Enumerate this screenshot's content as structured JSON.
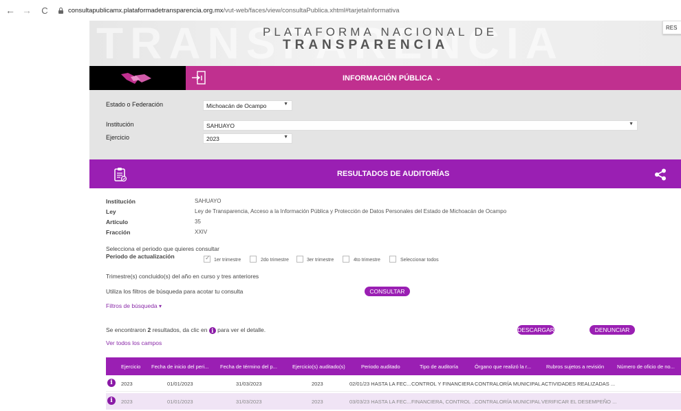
{
  "browser": {
    "url_host": "consultapublicamx.plataformadetransparencia.org.mx",
    "url_path": "/vut-web/faces/view/consultaPublica.xhtml#tarjetaInformativa"
  },
  "header": {
    "line1": "PLATAFORMA NACIONAL DE",
    "line2": "TRANSPARENCIA",
    "right_chip": "RES"
  },
  "info_bar": {
    "title": "INFORMACIÓN PÚBLICA",
    "chevron": "⌄"
  },
  "filters": {
    "state_label": "Estado o Federación",
    "state_value": "Michoacán de Ocampo",
    "institution_label": "Institución",
    "institution_value": "SAHUAYO",
    "year_label": "Ejercicio",
    "year_value": "2023"
  },
  "results_bar": {
    "title": "RESULTADOS DE AUDITORÍAS"
  },
  "details": {
    "institucion_label": "Institución",
    "institucion_value": "SAHUAYO",
    "ley_label": "Ley",
    "ley_value": "Ley de Transparencia, Acceso a la Información Pública y Protección de Datos Personales del Estado de Michoacán de Ocampo",
    "articulo_label": "Artículo",
    "articulo_value": "35",
    "fraccion_label": "Fracción",
    "fraccion_value": "XXIV"
  },
  "period": {
    "prompt": "Selecciona el periodo que quieres consultar",
    "label": "Periodo de actualización",
    "options": [
      "1er trimestre",
      "2do trimestre",
      "3er trimestre",
      "4to trimestre",
      "Seleccionar todos"
    ],
    "checked_index": 0,
    "note": "Trimestre(s) concluido(s) del año en curso y tres anteriores"
  },
  "search": {
    "hint": "Utiliza los filtros de búsqueda para acotar tu consulta",
    "consult_button": "CONSULTAR",
    "filters_link": "Filtros de búsqueda"
  },
  "results": {
    "found_prefix": "Se encontraron ",
    "found_count": "2",
    "found_suffix": " resultados, da clic en ",
    "found_end": " para ver el detalle.",
    "download_button": "DESCARGAR",
    "report_button": "DENUNCIAR",
    "all_fields_link": "Ver todos los campos"
  },
  "table": {
    "headers": [
      "Ejercicio",
      "Fecha de inicio del peri...",
      "Fecha de término del p...",
      "Ejercicio(s) auditado(s)",
      "Periodo auditado",
      "Tipo de auditoría",
      "Órgano que realizó la r...",
      "Rubros sujetos a revisión",
      "Número de oficio de no..."
    ],
    "rows": [
      [
        "2023",
        "01/01/2023",
        "31/03/2023",
        "2023",
        "02/01/23 HASTA LA FEC...",
        "CONTROL Y FINANCIERA",
        "CONTRALORÍA MUNICIPAL",
        "ACTIVIDADES REALIZADAS ..."
      ],
      [
        "2023",
        "01/01/2023",
        "31/03/2023",
        "2023",
        "03/03/23 HASTA LA FEC...",
        "FINANCIERA, CONTROL ...",
        "CONTRALORÍA MUNICIPAL",
        "VERIFICAR EL DESEMPEÑO ..."
      ]
    ]
  },
  "colors": {
    "magenta": "#c0308f",
    "purple": "#9a1fb3",
    "panel_gray": "#e4e4e4"
  }
}
